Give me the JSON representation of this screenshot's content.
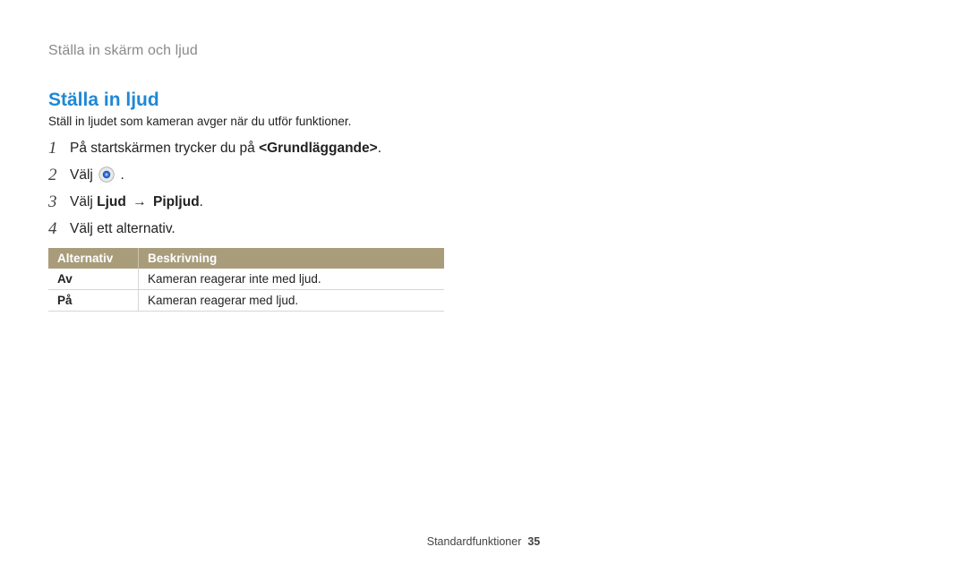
{
  "breadcrumb": "Ställa in skärm och ljud",
  "section": {
    "title": "Ställa in ljud",
    "desc": "Ställ in ljudet som kameran avger när du utför funktioner."
  },
  "icons": {
    "gear": "gear-icon"
  },
  "steps": [
    {
      "num": "1",
      "prefix": "På startskärmen trycker du på ",
      "bold": "<Grundläggande>",
      "suffix": "."
    },
    {
      "num": "2",
      "prefix": "Välj ",
      "icon": true,
      "suffix": " ."
    },
    {
      "num": "3",
      "prefix": "Välj ",
      "bold": "Ljud",
      "arrow": "→",
      "bold2": "Pipljud",
      "suffix": "."
    },
    {
      "num": "4",
      "prefix": "Välj ett alternativ.",
      "suffix": ""
    }
  ],
  "table": {
    "headers": {
      "alt": "Alternativ",
      "desc": "Beskrivning"
    },
    "rows": [
      {
        "alt": "Av",
        "desc": "Kameran reagerar inte med ljud."
      },
      {
        "alt": "På",
        "desc": "Kameran reagerar med ljud."
      }
    ]
  },
  "footer": {
    "label": "Standardfunktioner",
    "page": "35"
  }
}
